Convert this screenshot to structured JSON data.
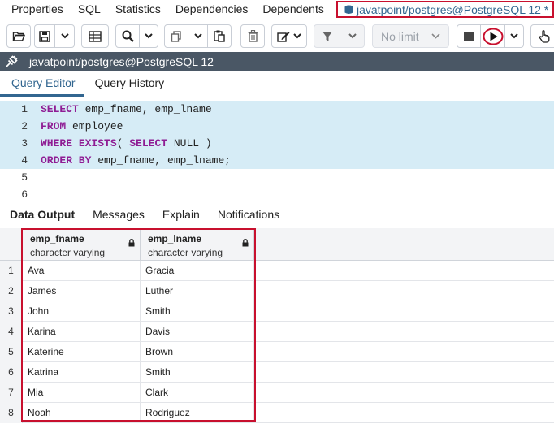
{
  "top_tabs": [
    {
      "label": "Properties"
    },
    {
      "label": "SQL"
    },
    {
      "label": "Statistics"
    },
    {
      "label": "Dependencies"
    },
    {
      "label": "Dependents"
    }
  ],
  "active_tab": {
    "label": "javatpoint/postgres@PostgreSQL 12 *"
  },
  "toolbar": {
    "limit_label": "No limit"
  },
  "connection": {
    "label": "javatpoint/postgres@PostgreSQL 12"
  },
  "editor_tabs": [
    {
      "label": "Query Editor"
    },
    {
      "label": "Query History"
    }
  ],
  "code_lines": [
    {
      "num": "1",
      "parts": [
        {
          "t": "SELECT",
          "kw": true
        },
        {
          "t": " emp_fname, emp_lname",
          "kw": false
        }
      ]
    },
    {
      "num": "2",
      "parts": [
        {
          "t": "FROM",
          "kw": true
        },
        {
          "t": " employee",
          "kw": false
        }
      ]
    },
    {
      "num": "3",
      "parts": [
        {
          "t": "WHERE",
          "kw": true
        },
        {
          "t": " ",
          "kw": false
        },
        {
          "t": "EXISTS",
          "kw": true
        },
        {
          "t": "( ",
          "kw": false
        },
        {
          "t": "SELECT",
          "kw": true
        },
        {
          "t": " NULL )",
          "kw": false
        }
      ]
    },
    {
      "num": "4",
      "parts": [
        {
          "t": "ORDER BY",
          "kw": true
        },
        {
          "t": " emp_fname, emp_lname;",
          "kw": false
        }
      ]
    },
    {
      "num": "5",
      "parts": []
    },
    {
      "num": "6",
      "parts": []
    }
  ],
  "output_tabs": [
    {
      "label": "Data Output"
    },
    {
      "label": "Messages"
    },
    {
      "label": "Explain"
    },
    {
      "label": "Notifications"
    }
  ],
  "grid": {
    "columns": [
      {
        "name": "emp_fname",
        "type": "character varying"
      },
      {
        "name": "emp_lname",
        "type": "character varying"
      }
    ],
    "rows": [
      {
        "num": "1",
        "fname": "Ava",
        "lname": "Gracia"
      },
      {
        "num": "2",
        "fname": "James",
        "lname": "Luther"
      },
      {
        "num": "3",
        "fname": "John",
        "lname": "Smith"
      },
      {
        "num": "4",
        "fname": "Karina",
        "lname": "Davis"
      },
      {
        "num": "5",
        "fname": "Katerine",
        "lname": "Brown"
      },
      {
        "num": "6",
        "fname": "Katrina",
        "lname": "Smith"
      },
      {
        "num": "7",
        "fname": "Mia",
        "lname": "Clark"
      },
      {
        "num": "8",
        "fname": "Noah",
        "lname": "Rodriguez"
      }
    ]
  },
  "colors": {
    "highlight": "#c8102e",
    "accent": "#326690",
    "keyword": "#8f1d94",
    "editor_bg": "#d6ecf6",
    "conn_bar": "#4a5765"
  }
}
